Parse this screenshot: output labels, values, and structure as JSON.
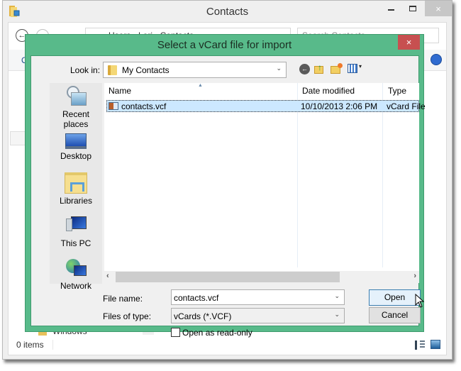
{
  "explorer": {
    "title": "Contacts",
    "close_glyph": "×",
    "back_glyph": "←",
    "address": "« Users › Lori › Contacts",
    "search_placeholder": "Search Contacts",
    "ribbon_partial": "O",
    "nav_partial": "Windows",
    "status": "0 items"
  },
  "dialog": {
    "title": "Select a vCard file for import",
    "close_glyph": "×",
    "look_in_label": "Look in:",
    "look_in_value": "My Contacts",
    "toolbar": {
      "back_glyph": "←",
      "up_glyph": "↑",
      "view_dropdown_glyph": "▾"
    },
    "places": [
      {
        "label": "Recent places",
        "icon": "recent-places-icon"
      },
      {
        "label": "Desktop",
        "icon": "desktop-icon"
      },
      {
        "label": "Libraries",
        "icon": "libraries-icon"
      },
      {
        "label": "This PC",
        "icon": "this-pc-icon"
      },
      {
        "label": "Network",
        "icon": "network-icon"
      }
    ],
    "columns": [
      "Name",
      "Date modified",
      "Type"
    ],
    "sort_glyph": "▲",
    "files": [
      {
        "name": "contacts.vcf",
        "date": "10/10/2013 2:06 PM",
        "type": "vCard File",
        "selected": true
      }
    ],
    "scroll_left": "‹",
    "scroll_right": "›",
    "file_name_label": "File name:",
    "file_name_value": "contacts.vcf",
    "file_type_label": "Files of type:",
    "file_type_value": "vCards (*.VCF)",
    "combo_arrow": "⌄",
    "read_only_label": "Open as read-only",
    "read_only_checked": false,
    "open_label": "Open",
    "cancel_label": "Cancel"
  }
}
